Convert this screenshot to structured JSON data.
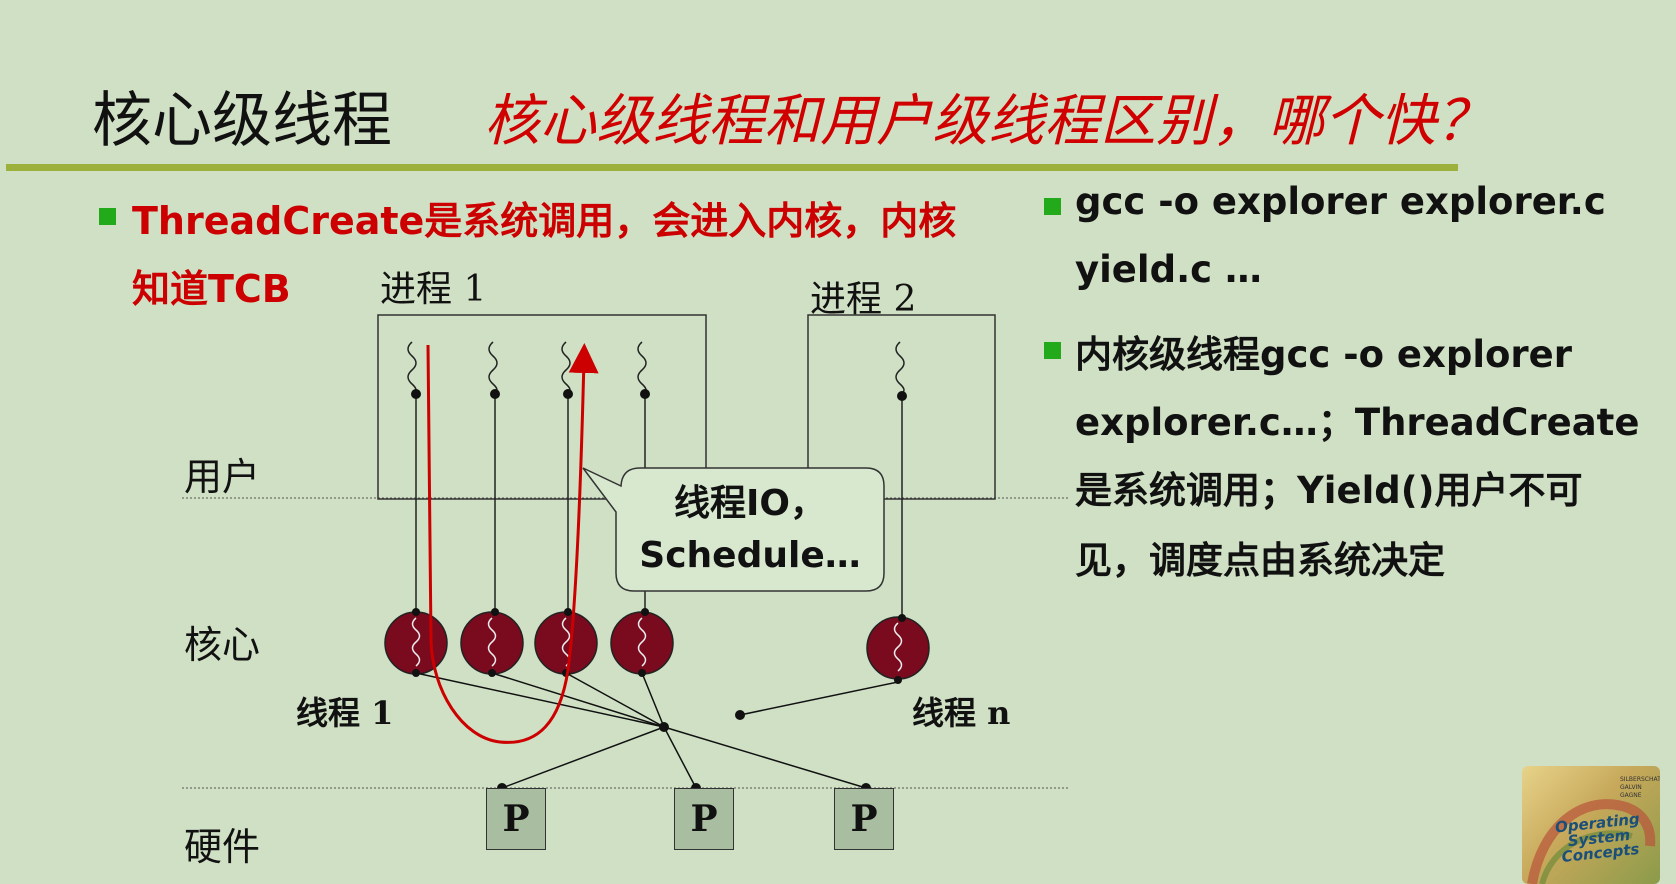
{
  "title": "核心级线程",
  "question": "核心级线程和用户级线程区别，哪个快？",
  "left_bullet": {
    "line1": "ThreadCreate是系统调用，会进入内核，内核",
    "line2": "知道TCB"
  },
  "right_bullets": [
    {
      "lines": [
        "gcc -o explorer explorer.c",
        "yield.c …"
      ]
    },
    {
      "lines": [
        "内核级线程gcc -o explorer",
        "explorer.c…；ThreadCreate",
        "是系统调用；Yield()用户不可",
        "见，调度点由系统决定"
      ]
    }
  ],
  "diagram": {
    "process1_label": "进程 1",
    "process2_label": "进程 2",
    "layer_user": "用户",
    "layer_kernel": "核心",
    "layer_hardware": "硬件",
    "thread1_label": "线程 1",
    "threadn_label": "线程 n",
    "speech_line1": "线程IO，",
    "speech_line2": "Schedule…",
    "processors": [
      "P",
      "P",
      "P"
    ]
  },
  "book_cover": {
    "title": "Operating System Concepts",
    "authors": "SILBERSCHATZ GALVIN GAGNE"
  },
  "colors": {
    "background": "#cfe0c4",
    "title_rule": "#9cb03c",
    "bullet": "#22aa1a",
    "accent_red": "#cc0000",
    "kernel_thread": "#7a0a1e"
  }
}
